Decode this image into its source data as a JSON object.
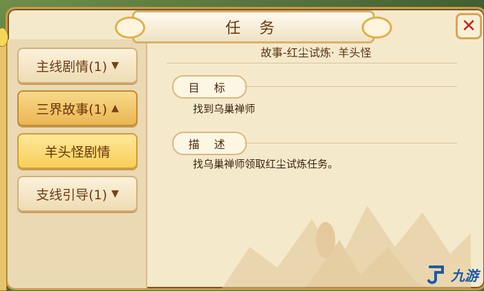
{
  "background": {
    "corner_text": ""
  },
  "dialog": {
    "title": "任 务",
    "close_label": "✕"
  },
  "sidebar": {
    "items": [
      {
        "label": "主线剧情(1)",
        "state": "collapsed"
      },
      {
        "label": "三界故事(1)",
        "state": "expanded"
      },
      {
        "label": "羊头怪剧情",
        "state": "selected"
      },
      {
        "label": "支线引导(1)",
        "state": "collapsed"
      }
    ]
  },
  "quest": {
    "story_title": "故事-红尘试炼· 羊头怪",
    "goal_label": "目 标",
    "goal_text": "找到乌巢禅师",
    "desc_label": "描 述",
    "desc_text": "找乌巢禅师领取红尘试炼任务。"
  },
  "watermark": {
    "text": "九游"
  },
  "colors": {
    "accent": "#d9a35a",
    "close": "#c4261a",
    "panel": "#f5e9cc",
    "watermark": "#1a5aa8"
  }
}
